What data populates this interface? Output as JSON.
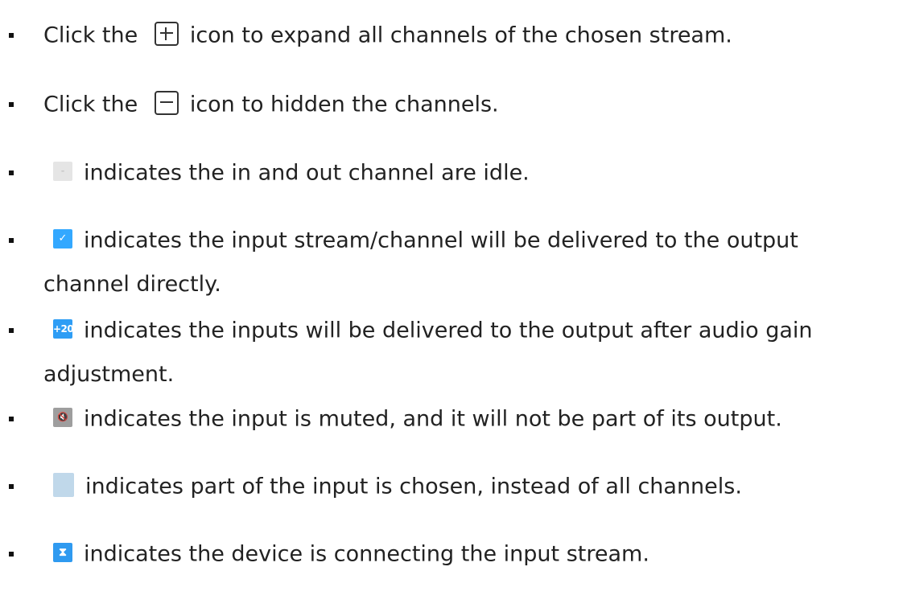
{
  "items": [
    {
      "icon": "plus-square-icon",
      "before": "Click the",
      "text": "icon to expand all channels of the chosen stream."
    },
    {
      "icon": "minus-square-icon",
      "before": "Click the",
      "text": "icon to hidden the channels."
    },
    {
      "icon": "idle-status-icon",
      "glyph": "-",
      "text": "indicates the in and out channel are idle."
    },
    {
      "icon": "check-status-icon",
      "glyph": "✓",
      "text": "indicates the input stream/channel will be delivered to the output",
      "text2": "channel directly."
    },
    {
      "icon": "gain-status-icon",
      "glyph": "+20",
      "text": "indicates the inputs will be delivered to the output after audio gain",
      "text2": "adjustment."
    },
    {
      "icon": "mute-status-icon",
      "glyph": "🔇",
      "text": "indicates the input is muted, and it will not be part of its output."
    },
    {
      "icon": "partial-status-icon",
      "text": "indicates part of the input is chosen, instead of all channels."
    },
    {
      "icon": "hourglass-status-icon",
      "glyph": "⧗",
      "text": "indicates the device is connecting the input stream."
    }
  ],
  "colors": {
    "check": "#33a8ff",
    "gain": "#2e9df5",
    "mute": "#9e9e9e",
    "partial": "#c0d8ea",
    "idle": "#e5e5e5",
    "hourglass": "#2f9af0"
  }
}
